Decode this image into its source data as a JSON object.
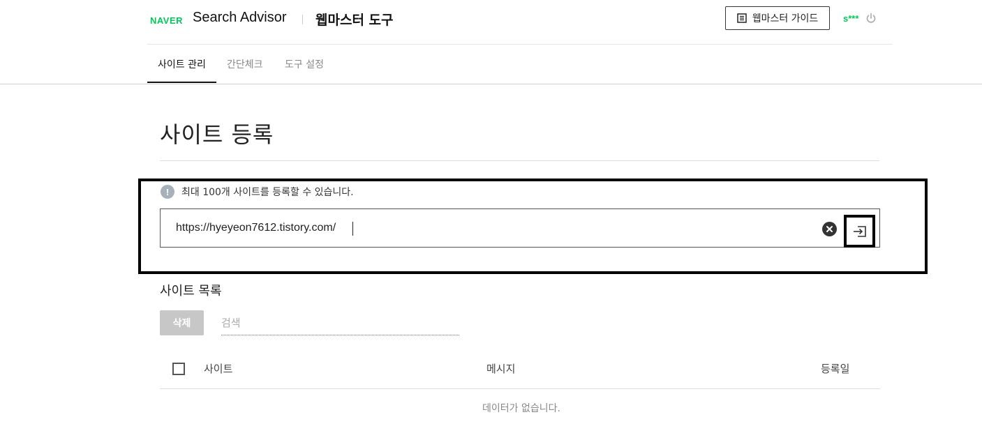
{
  "header": {
    "logo": "NAVER",
    "brand": "Search Advisor",
    "subtitle": "웹마스터 도구",
    "guide_button": "웹마스터 가이드",
    "user": "s***"
  },
  "tabs": [
    {
      "label": "사이트 관리",
      "active": true
    },
    {
      "label": "간단체크",
      "active": false
    },
    {
      "label": "도구 설정",
      "active": false
    }
  ],
  "page_title": "사이트 등록",
  "register": {
    "info_icon": "!",
    "info_text": "최대 100개 사이트를 등록할 수 있습니다.",
    "url_value": "https://hyeyeon7612.tistory.com/"
  },
  "site_list": {
    "title": "사이트 목록",
    "delete_button": "삭제",
    "search_placeholder": "검색",
    "columns": [
      "사이트",
      "메시지",
      "등록일"
    ],
    "empty_text": "데이터가 없습니다."
  },
  "colors": {
    "brand_green": "#03c75a",
    "disabled_button": "#c7c7c7",
    "info_icon": "#a7b1bb"
  }
}
